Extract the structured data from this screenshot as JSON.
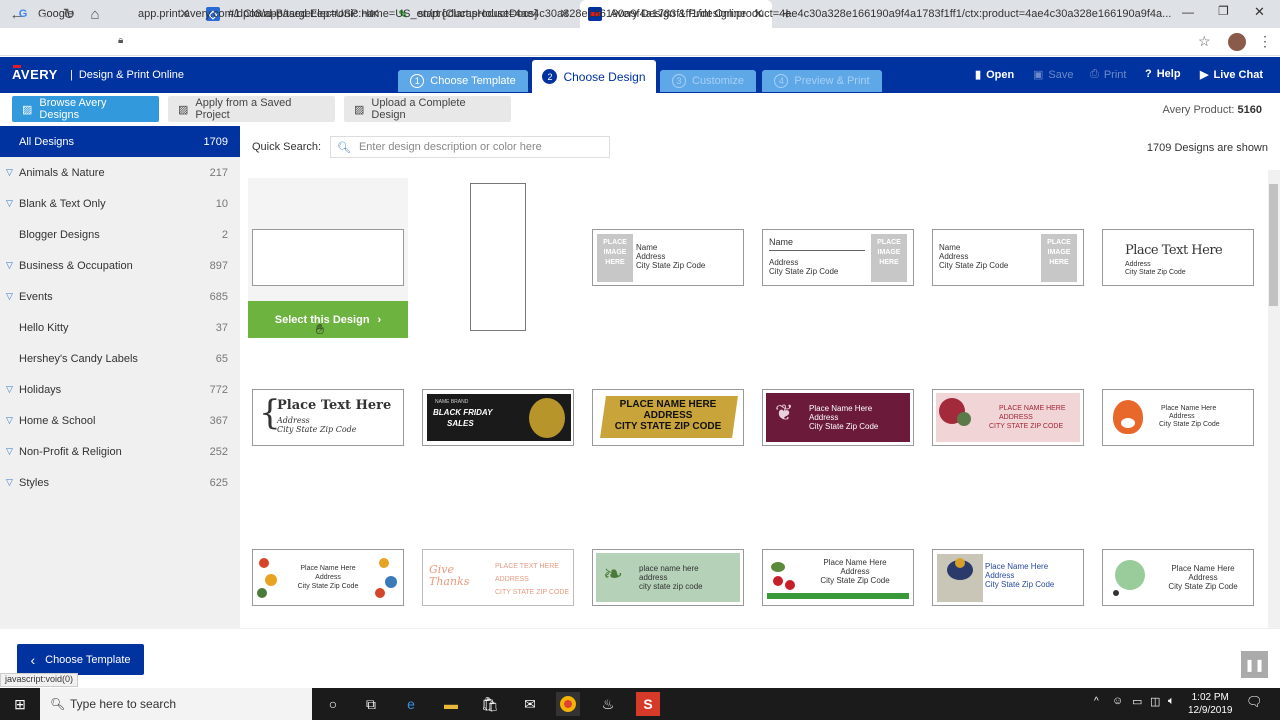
{
  "browser": {
    "tabs": [
      {
        "label": "Google",
        "icon": "google-icon"
      },
      {
        "label": "#1 Cloud-Based Electronic Healt",
        "icon": "ehr-icon"
      },
      {
        "label": "start [ClarasHouseDocs]",
        "icon": "docs-icon"
      },
      {
        "label": "Avery Design & Print Online",
        "icon": "avery-icon"
      }
    ],
    "url": "app.print.avery.com/dpo8/app/target:ep=USP:name=US_en/product:product=4ae4c30a328e166190a9f4a1783f1ff1/design:product=4ae4c30a328e166190a9f4a1783f1ff1/ctx:product=4ae4c30a328e166190a9f4a..."
  },
  "app": {
    "logo": "AVERY",
    "logo_sep": "|",
    "product_name": "Design & Print Online",
    "steps": [
      {
        "num": "1",
        "label": "Choose Template"
      },
      {
        "num": "2",
        "label": "Choose Design"
      },
      {
        "num": "3",
        "label": "Customize"
      },
      {
        "num": "4",
        "label": "Preview & Print"
      }
    ],
    "header_links": {
      "open": "Open",
      "save": "Save",
      "print": "Print",
      "help": "Help",
      "chat": "Live Chat"
    },
    "toolbar": {
      "browse": "Browse Avery Designs",
      "apply": "Apply from a Saved Project",
      "upload": "Upload a Complete Design",
      "avery_product_label": "Avery Product:",
      "avery_product_value": "5160"
    },
    "categories": [
      {
        "label": "All Designs",
        "count": "1709",
        "selected": true
      },
      {
        "label": "Animals & Nature",
        "count": "217",
        "expand": true
      },
      {
        "label": "Blank & Text Only",
        "count": "10",
        "expand": true
      },
      {
        "label": "Blogger Designs",
        "count": "2",
        "expand": false
      },
      {
        "label": "Business & Occupation",
        "count": "897",
        "expand": true
      },
      {
        "label": "Events",
        "count": "685",
        "expand": true
      },
      {
        "label": "Hello Kitty",
        "count": "37",
        "expand": false
      },
      {
        "label": "Hershey's Candy Labels",
        "count": "65",
        "expand": false
      },
      {
        "label": "Holidays",
        "count": "772",
        "expand": true
      },
      {
        "label": "Home & School",
        "count": "367",
        "expand": true
      },
      {
        "label": "Non-Profit & Religion",
        "count": "252",
        "expand": true
      },
      {
        "label": "Styles",
        "count": "625",
        "expand": true
      }
    ],
    "search": {
      "label": "Quick Search:",
      "placeholder": "Enter design description or color here"
    },
    "designs_shown": "1709 Designs are shown",
    "select_design": "Select this Design",
    "designs": {
      "d3": {
        "ph": "PLACE IMAGE HERE",
        "l1": "Name",
        "l2": "Address",
        "l3": "City State Zip Code"
      },
      "d4": {
        "ph": "PLACE IMAGE HERE",
        "l1": "Name",
        "l2": "Address",
        "l3": "City State Zip Code"
      },
      "d5": {
        "ph": "PLACE IMAGE HERE",
        "l1": "Name",
        "l2": "Address",
        "l3": "City State Zip Code"
      },
      "d6": {
        "l1": "Place Text Here",
        "l2": "Address",
        "l3": "City State Zip Code"
      },
      "d7": {
        "l1": "Place Text Here",
        "l2": "Address",
        "l3": "City State Zip Code"
      },
      "d8": {
        "l0": "NAME BRAND",
        "l1": "BLACK FRIDAY",
        "l2": "SALES"
      },
      "d9": {
        "l1": "PLACE NAME HERE",
        "l2": "ADDRESS",
        "l3": "CITY STATE ZIP CODE"
      },
      "d10": {
        "l1": "Place Name Here",
        "l2": "Address",
        "l3": "City State Zip Code"
      },
      "d11": {
        "l1": "PLACE NAME HERE",
        "l2": "ADDRESS",
        "l3": "CITY STATE ZIP CODE"
      },
      "d12": {
        "l1": "Place Name Here",
        "l2": "Address",
        "l3": "City State Zip Code"
      },
      "d13": {
        "l1": "Place Name Here",
        "l2": "Address",
        "l3": "City State Zip Code"
      },
      "d14": {
        "l0": "Give Thanks",
        "l1": "PLACE TEXT HERE",
        "l2": "ADDRESS",
        "l3": "CITY STATE ZIP CODE"
      },
      "d15": {
        "l1": "place name here",
        "l2": "address",
        "l3": "city state zip code"
      },
      "d16": {
        "l1": "Place Name Here",
        "l2": "Address",
        "l3": "City State Zip Code"
      },
      "d17": {
        "l1": "Place Name Here",
        "l2": "Address",
        "l3": "City State Zip Code"
      },
      "d18": {
        "l1": "Place Name Here",
        "l2": "Address",
        "l3": "City State Zip Code"
      }
    },
    "back_button": "Choose Template",
    "status_text": "javascript:void(0)"
  },
  "taskbar": {
    "search_placeholder": "Type here to search",
    "time": "1:02 PM",
    "date": "12/9/2019"
  },
  "colors": {
    "brand": "#0033a0",
    "accent": "#3399dd",
    "select_green": "#6db33f"
  }
}
